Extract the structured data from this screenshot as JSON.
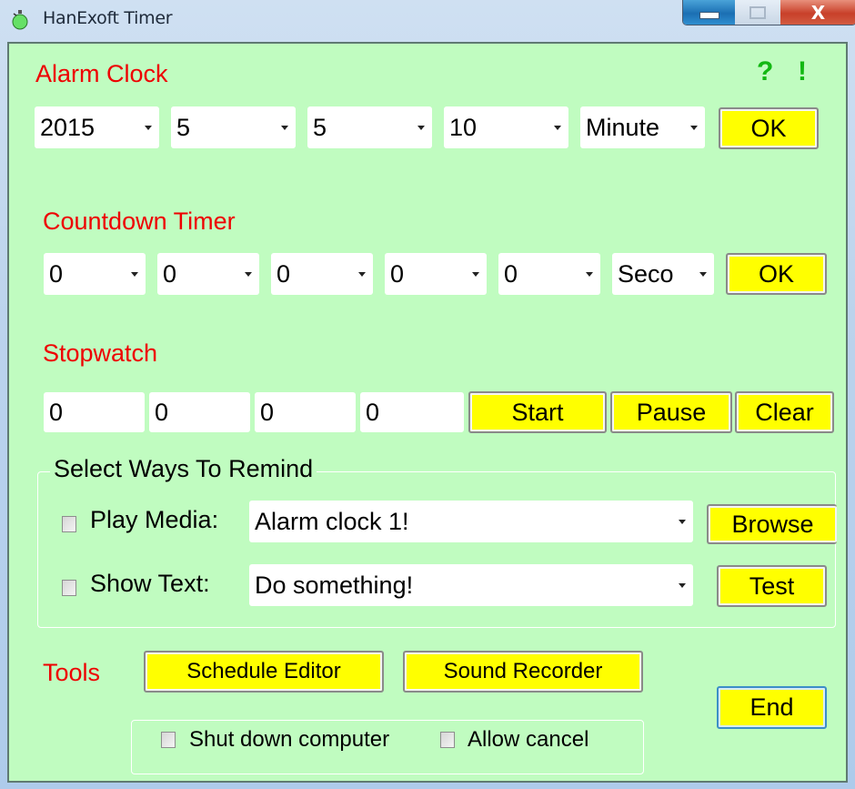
{
  "window": {
    "title": "HanExoft Timer",
    "close_glyph": "X",
    "icons": {
      "app": "stopwatch-icon",
      "minimize": "minimize-icon",
      "maximize": "maximize-icon",
      "close": "close-icon"
    }
  },
  "colors": {
    "background": "#C0FCC0",
    "section_title": "#EE0000",
    "help_icons": "#12B812",
    "button": "#FFFF00"
  },
  "help": {
    "question": "?",
    "exclaim": "!"
  },
  "alarm_clock": {
    "title": "Alarm Clock",
    "combos": [
      "2015",
      "5",
      "5",
      "10",
      "Minute"
    ],
    "ok_label": "OK"
  },
  "countdown": {
    "title": "Countdown Timer",
    "combos": [
      "0",
      "0",
      "0",
      "0",
      "0",
      "Seco"
    ],
    "ok_label": "OK"
  },
  "stopwatch": {
    "title": "Stopwatch",
    "fields": [
      "0",
      "0",
      "0",
      "0"
    ],
    "start_label": "Start",
    "pause_label": "Pause",
    "clear_label": "Clear"
  },
  "remind": {
    "title": "Select Ways To Remind",
    "play_media": {
      "label": "Play Media:",
      "checked": false,
      "value": "Alarm clock 1!",
      "button": "Browse"
    },
    "show_text": {
      "label": "Show Text:",
      "checked": false,
      "value": "Do something!",
      "button": "Test"
    }
  },
  "tools": {
    "title": "Tools",
    "schedule_editor": "Schedule Editor",
    "sound_recorder": "Sound Recorder",
    "end": "End",
    "shutdown": {
      "label": "Shut down computer",
      "checked": false
    },
    "allow_cancel": {
      "label": "Allow cancel",
      "checked": false
    }
  }
}
